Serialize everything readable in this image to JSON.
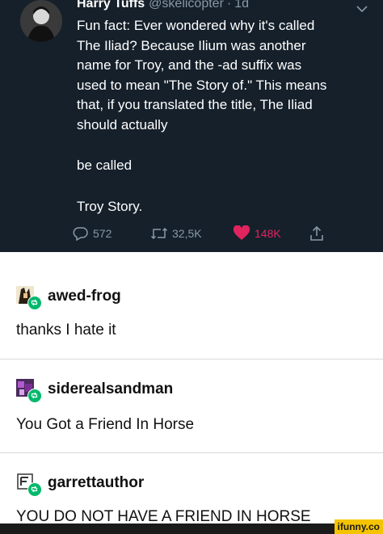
{
  "tweet": {
    "display_name": "Harry Tuffs",
    "handle": "@skelicopter",
    "separator": "·",
    "time": "1d",
    "body_lines": [
      "Fun fact: Ever wondered why it's called",
      "The Iliad? Because Ilium was another",
      "name for Troy, and the -ad suffix was",
      "used to mean \"The Story of.\" This means",
      "that, if you translated the title, The Iliad",
      "should actually"
    ],
    "line_2": "be called",
    "line_3": "Troy Story.",
    "reply_count": "572",
    "retweet_count": "32,5K",
    "like_count": "148K",
    "colors": {
      "background": "#15202b",
      "muted": "#8899a6",
      "like": "#e0245e"
    }
  },
  "posts": [
    {
      "username": "awed-frog",
      "text": "thanks I hate it"
    },
    {
      "username": "siderealsandman",
      "text": "You Got a Friend In Horse"
    },
    {
      "username": "garrettauthor",
      "text": "YOU DO NOT HAVE A FRIEND IN HORSE"
    }
  ],
  "watermark": {
    "text": "ifunny.co"
  },
  "icons": [
    "reply-icon",
    "retweet-icon",
    "heart-icon",
    "share-icon",
    "chevron-down-icon",
    "reblog-icon"
  ]
}
